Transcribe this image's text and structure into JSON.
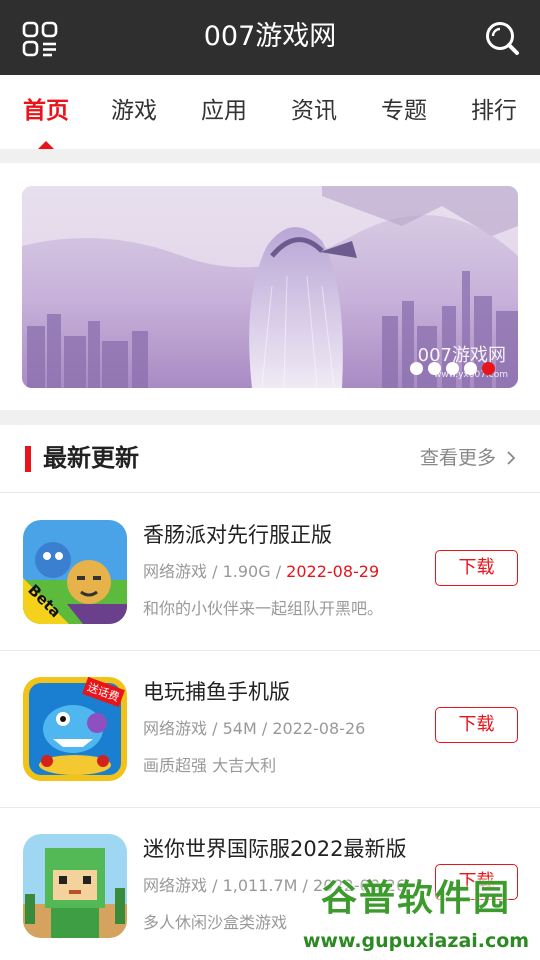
{
  "header": {
    "title": "007游戏网",
    "menu_icon": "grid-menu-icon",
    "search_icon": "search-icon",
    "bg": "#2f2f2f"
  },
  "tabs": [
    {
      "label": "首页",
      "active": true
    },
    {
      "label": "游戏",
      "active": false
    },
    {
      "label": "应用",
      "active": false
    },
    {
      "label": "资讯",
      "active": false
    },
    {
      "label": "专题",
      "active": false
    },
    {
      "label": "排行",
      "active": false
    }
  ],
  "banner": {
    "watermark": "007游戏网",
    "watermark_url": "www.yx007.com",
    "slide_count": 5,
    "active_slide": 5
  },
  "section": {
    "title": "最新更新",
    "more": "查看更多"
  },
  "items": [
    {
      "name": "香肠派对先行服正版",
      "category": "网络游戏",
      "size": "1.90G",
      "date": "2022-08-29",
      "date_highlight": true,
      "desc": "和你的小伙伴来一起组队开黑吧。",
      "button": "下载",
      "icon_badge": "Beta"
    },
    {
      "name": "电玩捕鱼手机版",
      "category": "网络游戏",
      "size": "54M",
      "date": "2022-08-26",
      "date_highlight": false,
      "desc": "画质超强 大吉大利",
      "button": "下载",
      "icon_badge": "送话费"
    },
    {
      "name": "迷你世界国际服2022最新版",
      "category": "网络游戏",
      "size": "1,011.7M",
      "date": "2022-08-26",
      "date_highlight": false,
      "desc": "多人休闲沙盒类游戏",
      "button": "下载",
      "icon_badge": ""
    }
  ],
  "watermark": {
    "text": "谷普软件园",
    "url": "www.gupuxiazai.com"
  },
  "colors": {
    "accent": "#e8141a",
    "topbar": "#2f2f2f",
    "separator": "#f0f0f0"
  }
}
